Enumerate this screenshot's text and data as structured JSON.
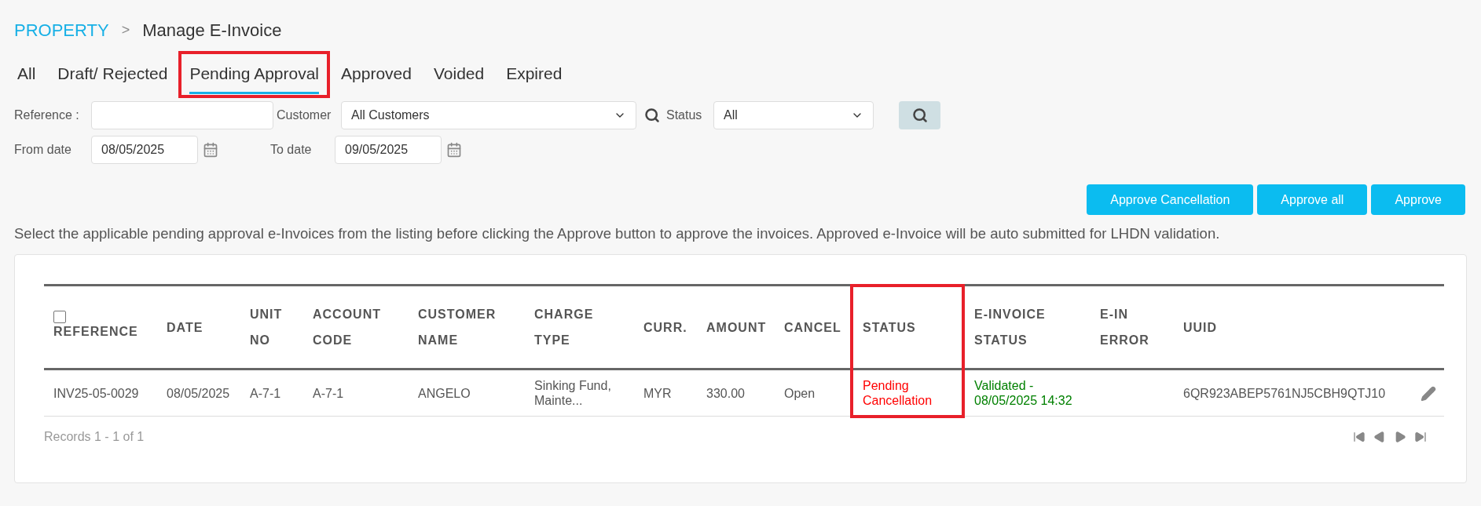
{
  "breadcrumb": {
    "root": "PROPERTY",
    "separator": ">",
    "current": "Manage E-Invoice"
  },
  "tabs": [
    {
      "label": "All",
      "selected": false,
      "highlighted": false
    },
    {
      "label": "Draft/ Rejected",
      "selected": false,
      "highlighted": false
    },
    {
      "label": "Pending Approval",
      "selected": true,
      "highlighted": true
    },
    {
      "label": "Approved",
      "selected": false,
      "highlighted": false
    },
    {
      "label": "Voided",
      "selected": false,
      "highlighted": false
    },
    {
      "label": "Expired",
      "selected": false,
      "highlighted": false
    }
  ],
  "filters": {
    "reference_label": "Reference :",
    "customer_label": "Customer",
    "customer_value": "All Customers",
    "status_label": "Status",
    "status_value": "All",
    "from_label": "From date",
    "from_value": "08/05/2025",
    "to_label": "To date",
    "to_value": "09/05/2025"
  },
  "actions": [
    "Approve Cancellation",
    "Approve all",
    "Approve"
  ],
  "info": "Select the applicable pending approval e-Invoices from the listing before clicking the Approve button to approve the invoices. Approved e-Invoice will be auto submitted for LHDN validation.",
  "table": {
    "select_all_checked": false,
    "columns": [
      {
        "lines": [
          "REFERENCE"
        ],
        "highlighted": false
      },
      {
        "lines": [
          "DATE"
        ],
        "highlighted": false
      },
      {
        "lines": [
          "UNIT",
          "NO"
        ],
        "highlighted": false
      },
      {
        "lines": [
          "ACCOUNT",
          "CODE"
        ],
        "highlighted": false
      },
      {
        "lines": [
          "CUSTOMER",
          "NAME"
        ],
        "highlighted": false
      },
      {
        "lines": [
          "CHARGE",
          "TYPE"
        ],
        "highlighted": false
      },
      {
        "lines": [
          "CURR."
        ],
        "highlighted": false
      },
      {
        "lines": [
          "AMOUNT"
        ],
        "highlighted": false
      },
      {
        "lines": [
          "CANCEL"
        ],
        "highlighted": false
      },
      {
        "lines": [
          "STATUS"
        ],
        "highlighted": true
      },
      {
        "lines": [
          "E-INVOICE",
          "STATUS"
        ],
        "highlighted": false
      },
      {
        "lines": [
          "E-IN",
          "ERROR"
        ],
        "highlighted": false
      },
      {
        "lines": [
          "UUID"
        ],
        "highlighted": false
      }
    ],
    "rows": [
      {
        "cells": [
          {
            "text": "INV25-05-0029",
            "kind": "plain"
          },
          {
            "text": "08/05/2025",
            "kind": "plain"
          },
          {
            "text": "A-7-1",
            "kind": "plain"
          },
          {
            "text": "A-7-1",
            "kind": "plain"
          },
          {
            "text": "ANGELO",
            "kind": "plain"
          },
          {
            "text": "Sinking Fund, Mainte...",
            "kind": "plain"
          },
          {
            "text": "MYR",
            "kind": "plain"
          },
          {
            "text": "330.00",
            "kind": "plain"
          },
          {
            "text": "Open",
            "kind": "plain"
          },
          {
            "text": "Pending Cancellation",
            "kind": "alert"
          },
          {
            "text": "Validated - 08/05/2025 14:32",
            "kind": "success"
          },
          {
            "kind": "empty"
          },
          {
            "text": "6QR923ABEP5761NJ5CBH9QTJ10",
            "kind": "plain"
          }
        ]
      }
    ],
    "records": "Records 1 - 1 of 1"
  }
}
